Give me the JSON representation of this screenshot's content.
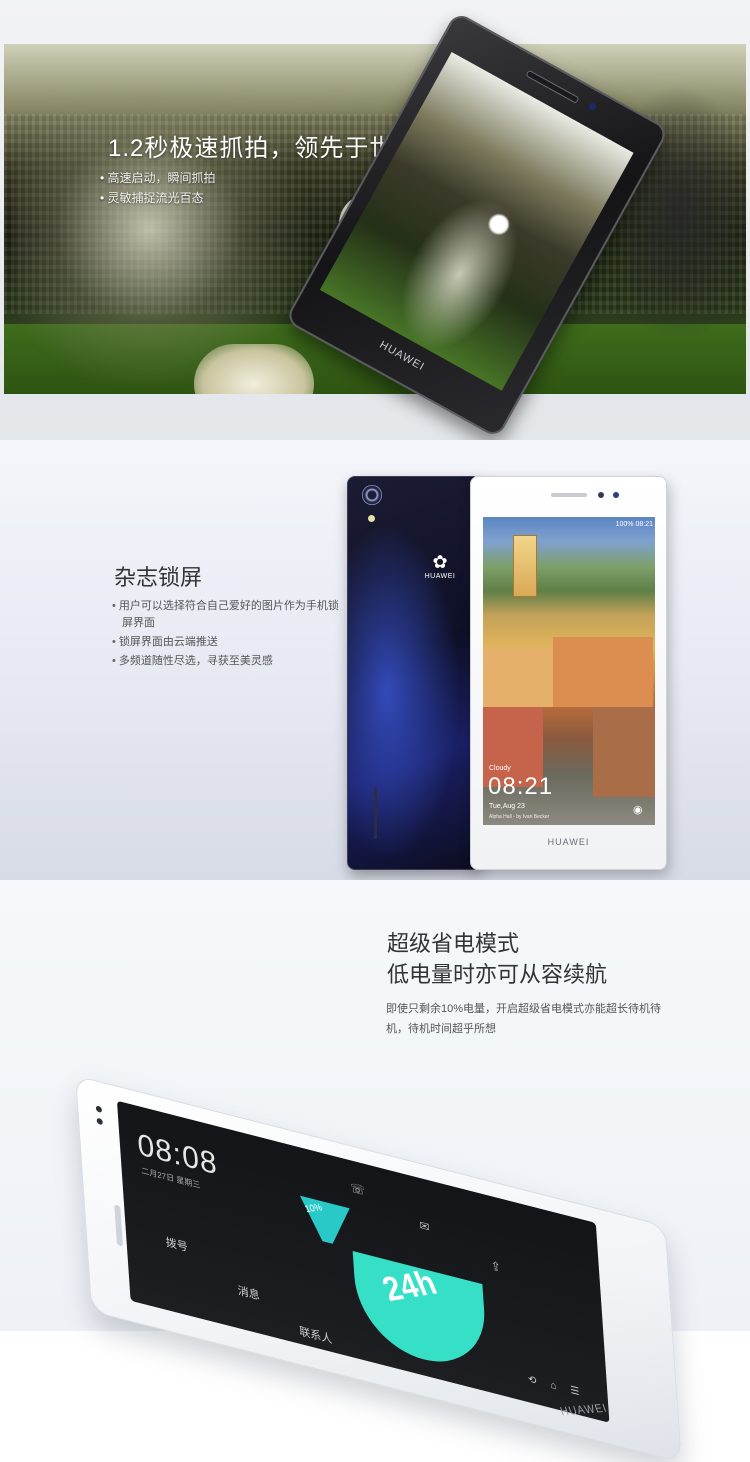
{
  "hero": {
    "title": "1.2秒极速抓拍，领先于世",
    "bullets": [
      "高速启动，瞬间抓拍",
      "灵敏捕捉流光百态"
    ],
    "phone_brand": "HUAWEI"
  },
  "lock_screen": {
    "title": "杂志锁屏",
    "bullets": [
      "用户可以选择符合自己爱好的图片作为手机锁屏界面",
      "锁屏界面由云端推送",
      "多频道随性尽选，寻获至美灵感"
    ],
    "phone_back_logo_text": "HUAWEI",
    "status": "100% 08:21",
    "weather": "Cloudy",
    "time": "08:21",
    "date": "Tue,Aug 23",
    "credit": "Alpha Hall - by Ivan Becker",
    "phone_front_brand": "HUAWEI"
  },
  "power_saving": {
    "title_line1": "超级省电模式",
    "title_line2": "低电量时亦可从容续航",
    "description": "即使只剩余10%电量，开启超级省电模式亦能超长待机待机，待机时间超乎所想",
    "clock": "08:08",
    "clock_sub": "二月27日 星期三",
    "battery_percent": "10%",
    "standby": "24h",
    "tiles": [
      "拨号",
      "消息",
      "联系人"
    ],
    "phone_brand": "HUAWEI"
  },
  "icons": [
    "huawei-logo-icon",
    "camera-icon",
    "phone-icon",
    "message-icon",
    "share-icon",
    "back-icon",
    "home-icon",
    "menu-icon"
  ],
  "colors": {
    "accent_teal": "#35e0c6",
    "text_dark": "#333333",
    "text_body": "#555555"
  }
}
